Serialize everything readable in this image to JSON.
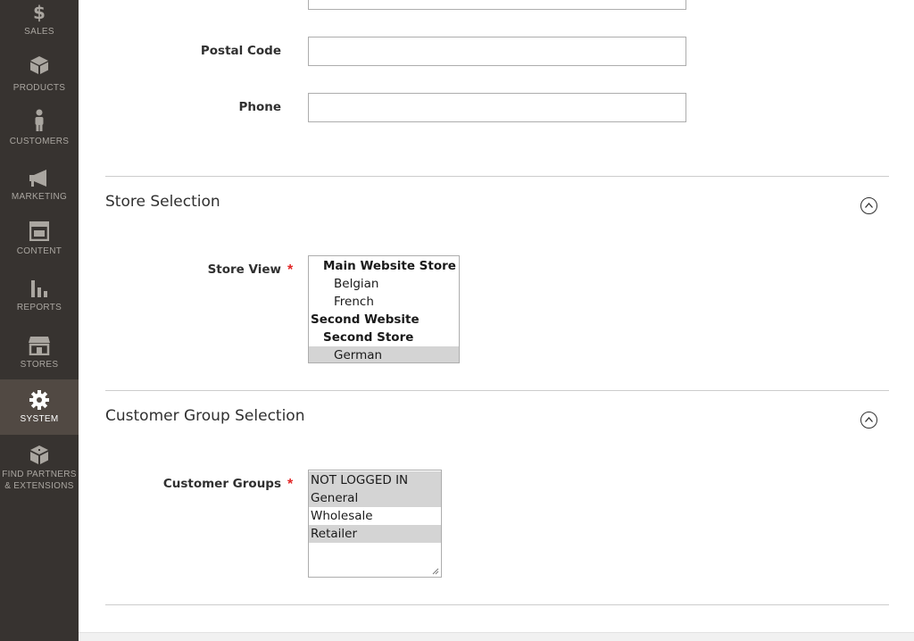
{
  "sidebar": {
    "items": [
      {
        "label": "SALES",
        "icon": "dollar-icon"
      },
      {
        "label": "PRODUCTS",
        "icon": "cube-icon"
      },
      {
        "label": "CUSTOMERS",
        "icon": "person-icon"
      },
      {
        "label": "MARKETING",
        "icon": "megaphone-icon"
      },
      {
        "label": "CONTENT",
        "icon": "layout-icon"
      },
      {
        "label": "REPORTS",
        "icon": "bar-chart-icon"
      },
      {
        "label": "STORES",
        "icon": "storefront-icon"
      },
      {
        "label": "SYSTEM",
        "icon": "gear-icon",
        "active": true
      },
      {
        "label_line1": "FIND PARTNERS",
        "label_line2": "& EXTENSIONS",
        "icon": "blocks-icon"
      }
    ]
  },
  "form": {
    "postal_code": {
      "label": "Postal Code",
      "value": ""
    },
    "phone": {
      "label": "Phone",
      "value": ""
    }
  },
  "store_selection": {
    "title": "Store Selection",
    "store_view_label": "Store View",
    "required_mark": "*",
    "options": [
      {
        "text": "Main Website Store",
        "kind": "group",
        "level": 1
      },
      {
        "text": "Belgian",
        "kind": "option",
        "level": 2
      },
      {
        "text": "French",
        "kind": "option",
        "level": 2
      },
      {
        "text": "Second Website",
        "kind": "group",
        "level": 0
      },
      {
        "text": "Second Store",
        "kind": "group",
        "level": 1
      },
      {
        "text": "German",
        "kind": "option",
        "level": 2,
        "selected": true
      }
    ]
  },
  "customer_group_selection": {
    "title": "Customer Group Selection",
    "groups_label": "Customer Groups",
    "required_mark": "*",
    "options": [
      {
        "text": "NOT LOGGED IN",
        "selected": true
      },
      {
        "text": "General",
        "selected": true
      },
      {
        "text": "Wholesale",
        "selected": false
      },
      {
        "text": "Retailer",
        "selected": true
      }
    ]
  },
  "colors": {
    "sidebar_bg": "#373330",
    "sidebar_active_bg": "#514943",
    "required": "#e22626",
    "selected_option_bg": "#d4d4d4"
  }
}
